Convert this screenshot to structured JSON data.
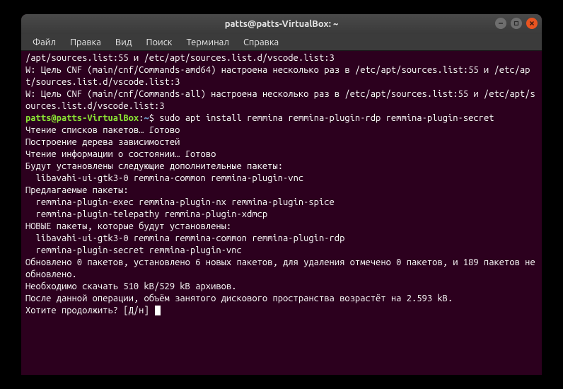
{
  "titlebar": {
    "title": "patts@patts-VirtualBox: ~"
  },
  "menubar": {
    "items": [
      "Файл",
      "Правка",
      "Вид",
      "Поиск",
      "Терминал",
      "Справка"
    ]
  },
  "prompt": {
    "user_host": "patts@patts-VirtualBox",
    "colon": ":",
    "path": "~",
    "dollar": "$",
    "command": "sudo apt install remmina remmina-plugin-rdp remmina-plugin-secret"
  },
  "lines": {
    "l0": "/apt/sources.list:55 и /etc/apt/sources.list.d/vscode.list:3",
    "l1": "W: Цель CNF (main/cnf/Commands-amd64) настроена несколько раз в /etc/apt/sources.list:55 и /etc/apt/sources.list.d/vscode.list:3",
    "l2": "W: Цель CNF (main/cnf/Commands-all) настроена несколько раз в /etc/apt/sources.list:55 и /etc/apt/sources.list.d/vscode.list:3",
    "l3": "Чтение списков пакетов… Готово",
    "l4": "Построение дерева зависимостей",
    "l5": "Чтение информации о состоянии… Готово",
    "l6": "Будут установлены следующие дополнительные пакеты:",
    "l7": "  libavahi-ui-gtk3-0 remmina-common remmina-plugin-vnc",
    "l8": "Предлагаемые пакеты:",
    "l9": "  remmina-plugin-exec remmina-plugin-nx remmina-plugin-spice",
    "l10": "  remmina-plugin-telepathy remmina-plugin-xdmcp",
    "l11": "НОВЫЕ пакеты, которые будут установлены:",
    "l12": "  libavahi-ui-gtk3-0 remmina remmina-common remmina-plugin-rdp",
    "l13": "  remmina-plugin-secret remmina-plugin-vnc",
    "l14": "Обновлено 0 пакетов, установлено 6 новых пакетов, для удаления отмечено 0 пакетов, и 189 пакетов не обновлено.",
    "l15": "Необходимо скачать 510 kB/529 kB архивов.",
    "l16": "После данной операции, объём занятого дискового пространства возрастёт на 2.593 kB.",
    "l17": "Хотите продолжить? [Д/н] "
  }
}
